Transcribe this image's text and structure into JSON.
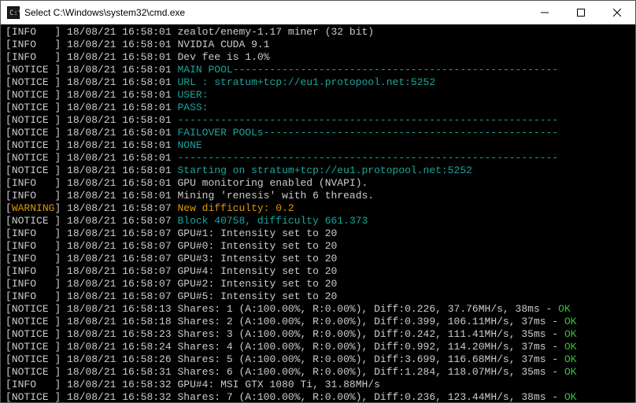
{
  "window": {
    "title": "Select C:\\Windows\\system32\\cmd.exe"
  },
  "lines": [
    {
      "level": "INFO",
      "ts": "18/08/21 16:58:01",
      "msg": "zealot/enemy-1.17 miner (32 bit)",
      "msgClass": "msg"
    },
    {
      "level": "INFO",
      "ts": "18/08/21 16:58:01",
      "msg": "NVIDIA CUDA 9.1",
      "msgClass": "msg"
    },
    {
      "level": "INFO",
      "ts": "18/08/21 16:58:01",
      "msg": "Dev fee is 1.0%",
      "msgClass": "msg"
    },
    {
      "level": "NOTICE",
      "ts": "18/08/21 16:58:01",
      "msg": "MAIN POOL-----------------------------------------------------",
      "msgClass": "teal"
    },
    {
      "level": "NOTICE",
      "ts": "18/08/21 16:58:01",
      "msg": "URL : stratum+tcp://eu1.protopool.net:5252",
      "msgClass": "teal"
    },
    {
      "level": "NOTICE",
      "ts": "18/08/21 16:58:01",
      "msg": "USER:",
      "msgClass": "teal"
    },
    {
      "level": "NOTICE",
      "ts": "18/08/21 16:58:01",
      "msg": "PASS:",
      "msgClass": "teal"
    },
    {
      "level": "NOTICE",
      "ts": "18/08/21 16:58:01",
      "msg": "--------------------------------------------------------------",
      "msgClass": "teal"
    },
    {
      "level": "NOTICE",
      "ts": "18/08/21 16:58:01",
      "msg": "FAILOVER POOLs------------------------------------------------",
      "msgClass": "teal"
    },
    {
      "level": "NOTICE",
      "ts": "18/08/21 16:58:01",
      "msg": "NONE",
      "msgClass": "teal"
    },
    {
      "level": "NOTICE",
      "ts": "18/08/21 16:58:01",
      "msg": "--------------------------------------------------------------",
      "msgClass": "teal"
    },
    {
      "level": "NOTICE",
      "ts": "18/08/21 16:58:01",
      "msg": "Starting on stratum+tcp://eu1.protopool.net:5252",
      "msgClass": "teal"
    },
    {
      "level": "INFO",
      "ts": "18/08/21 16:58:01",
      "msg": "GPU monitoring enabled (NVAPI).",
      "msgClass": "msg"
    },
    {
      "level": "INFO",
      "ts": "18/08/21 16:58:01",
      "msg": "Mining 'renesis' with 6 threads.",
      "msgClass": "msg"
    },
    {
      "level": "WARNING",
      "ts": "18/08/21 16:58:07",
      "msg": "New difficulty: 0.2",
      "msgClass": "yellow"
    },
    {
      "level": "NOTICE",
      "ts": "18/08/21 16:58:07",
      "msg": "Block 40758, difficulty 661.373",
      "msgClass": "teal"
    },
    {
      "level": "INFO",
      "ts": "18/08/21 16:58:07",
      "msg": "GPU#1: Intensity set to 20",
      "msgClass": "msg"
    },
    {
      "level": "INFO",
      "ts": "18/08/21 16:58:07",
      "msg": "GPU#0: Intensity set to 20",
      "msgClass": "msg"
    },
    {
      "level": "INFO",
      "ts": "18/08/21 16:58:07",
      "msg": "GPU#3: Intensity set to 20",
      "msgClass": "msg"
    },
    {
      "level": "INFO",
      "ts": "18/08/21 16:58:07",
      "msg": "GPU#4: Intensity set to 20",
      "msgClass": "msg"
    },
    {
      "level": "INFO",
      "ts": "18/08/21 16:58:07",
      "msg": "GPU#2: Intensity set to 20",
      "msgClass": "msg"
    },
    {
      "level": "INFO",
      "ts": "18/08/21 16:58:07",
      "msg": "GPU#5: Intensity set to 20",
      "msgClass": "msg"
    },
    {
      "level": "NOTICE",
      "ts": "18/08/21 16:58:13",
      "msg": "Shares: 1 (A:100.00%, R:0.00%), Diff:0.226, 37.76MH/s, 38ms - ",
      "msgClass": "msg",
      "suffix": "OK",
      "suffixClass": "green"
    },
    {
      "level": "NOTICE",
      "ts": "18/08/21 16:58:18",
      "msg": "Shares: 2 (A:100.00%, R:0.00%), Diff:0.399, 106.11MH/s, 37ms - ",
      "msgClass": "msg",
      "suffix": "OK",
      "suffixClass": "green"
    },
    {
      "level": "NOTICE",
      "ts": "18/08/21 16:58:23",
      "msg": "Shares: 3 (A:100.00%, R:0.00%), Diff:0.242, 111.41MH/s, 35ms - ",
      "msgClass": "msg",
      "suffix": "OK",
      "suffixClass": "green"
    },
    {
      "level": "NOTICE",
      "ts": "18/08/21 16:58:24",
      "msg": "Shares: 4 (A:100.00%, R:0.00%), Diff:0.992, 114.20MH/s, 37ms - ",
      "msgClass": "msg",
      "suffix": "OK",
      "suffixClass": "green"
    },
    {
      "level": "NOTICE",
      "ts": "18/08/21 16:58:26",
      "msg": "Shares: 5 (A:100.00%, R:0.00%), Diff:3.699, 116.68MH/s, 37ms - ",
      "msgClass": "msg",
      "suffix": "OK",
      "suffixClass": "green"
    },
    {
      "level": "NOTICE",
      "ts": "18/08/21 16:58:31",
      "msg": "Shares: 6 (A:100.00%, R:0.00%), Diff:1.284, 118.07MH/s, 35ms - ",
      "msgClass": "msg",
      "suffix": "OK",
      "suffixClass": "green"
    },
    {
      "level": "INFO",
      "ts": "18/08/21 16:58:32",
      "msg": "GPU#4: MSI GTX 1080 Ti, 31.88MH/s",
      "msgClass": "msg"
    },
    {
      "level": "NOTICE",
      "ts": "18/08/21 16:58:32",
      "msg": "Shares: 7 (A:100.00%, R:0.00%), Diff:0.236, 123.44MH/s, 38ms - ",
      "msgClass": "msg",
      "suffix": "OK",
      "suffixClass": "green"
    }
  ]
}
